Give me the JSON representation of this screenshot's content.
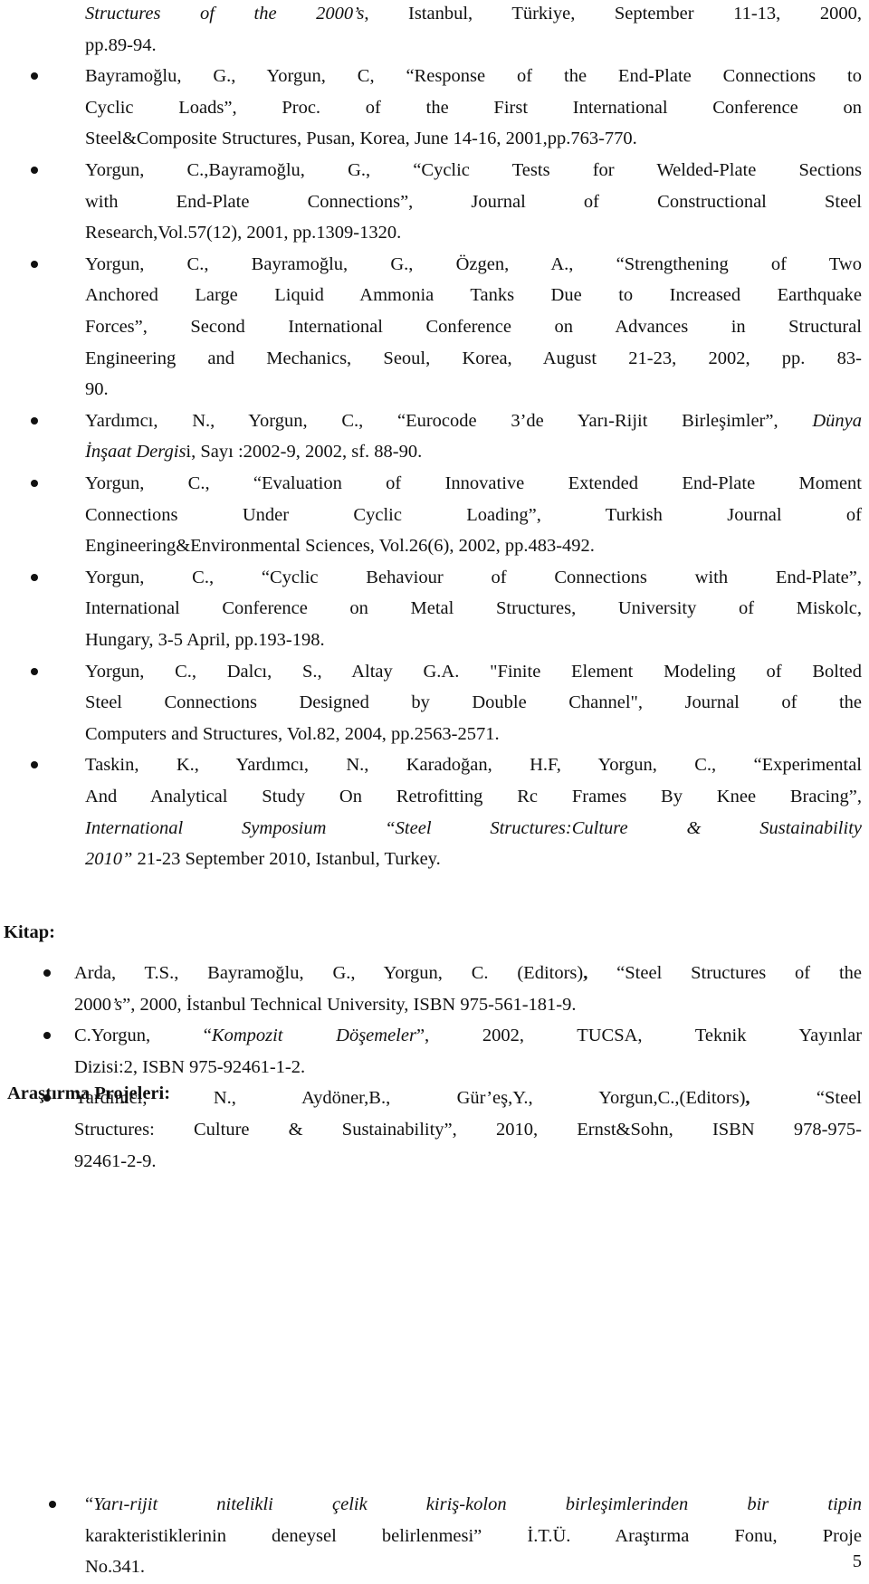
{
  "publications": {
    "items": [
      {
        "lines": [
          [
            {
              "t": "Structures of the 2000’s",
              "i": true
            },
            {
              "t": ", Istanbul, Türkiye, September 11-13, 2000,"
            }
          ],
          [
            {
              "t": "pp.89-94."
            }
          ]
        ],
        "bullet": false
      },
      {
        "lines": [
          [
            {
              "t": "Bayramoğlu, G., Yorgun, C, “Response of the End-Plate Connections to"
            }
          ],
          [
            {
              "t": "Cyclic Loads”, Proc. of the First International Conference on"
            }
          ],
          [
            {
              "t": "Steel&Composite Structures, Pusan, Korea, June 14-16, 2001,pp.763-770."
            }
          ]
        ],
        "bullet": true
      },
      {
        "lines": [
          [
            {
              "t": "Yorgun, C.,Bayramoğlu, G., “Cyclic Tests for Welded-Plate Sections"
            }
          ],
          [
            {
              "t": "with End-Plate Connections”, Journal of  Constructional Steel"
            }
          ],
          [
            {
              "t": "Research,Vol.57(12), 2001, pp.1309-1320."
            }
          ]
        ],
        "bullet": true
      },
      {
        "lines": [
          [
            {
              "t": "Yorgun, C., Bayramoğlu, G., Özgen, A., “Strengthening of Two"
            }
          ],
          [
            {
              "t": "Anchored Large Liquid Ammonia Tanks Due to Increased Earthquake"
            }
          ],
          [
            {
              "t": "Forces”, Second International Conference on Advances in Structural"
            }
          ],
          [
            {
              "t": "Engineering and Mechanics, Seoul, Korea, August 21-23, 2002, pp. 83-"
            }
          ],
          [
            {
              "t": "90."
            }
          ]
        ],
        "bullet": true
      },
      {
        "lines": [
          [
            {
              "t": "Yardımcı, N., Yorgun, C., “Eurocode 3’de Yarı-Rijit Birleşimler”, "
            },
            {
              "t": "Dünya",
              "i": true
            }
          ],
          [
            {
              "t": "İnşaat Dergis",
              "i": true
            },
            {
              "t": "i, Sayı :2002-9, 2002, sf. 88-90."
            }
          ]
        ],
        "bullet": true
      },
      {
        "lines": [
          [
            {
              "t": "Yorgun, C., “Evaluation of Innovative Extended End-Plate Moment"
            }
          ],
          [
            {
              "t": "Connections Under Cyclic Loading”, Turkish Journal of"
            }
          ],
          [
            {
              "t": "Engineering&Environmental Sciences, Vol.26(6), 2002, pp.483-492."
            }
          ]
        ],
        "bullet": true
      },
      {
        "lines": [
          [
            {
              "t": "Yorgun, C., “Cyclic Behaviour of Connections with End-Plate”,"
            }
          ],
          [
            {
              "t": "International Conference on Metal Structures, University of Miskolc,"
            }
          ],
          [
            {
              "t": "Hungary, 3-5 April, pp.193-198."
            }
          ]
        ],
        "bullet": true
      },
      {
        "lines": [
          [
            {
              "t": "Yorgun, C., Dalcı, S., Altay G.A. \"Finite Element Modeling of Bolted"
            }
          ],
          [
            {
              "t": "Steel Connections Designed by Double Channel\", Journal of the"
            }
          ],
          [
            {
              "t": "Computers and Structures, Vol.82, 2004, pp.2563-2571."
            }
          ]
        ],
        "bullet": true
      },
      {
        "lines": [
          [
            {
              "t": "Taskin, K., Yardımcı, N., Karadoğan, H.F, Yorgun, C., “Experimental"
            }
          ],
          [
            {
              "t": "And Analytical Study On Retrofitting Rc Frames By Knee Bracing”,"
            }
          ],
          [
            {
              "t": "International Symposium “Steel Structures:Culture & Sustainability",
              "i": true
            }
          ],
          [
            {
              "t": "2010”",
              "i": true
            },
            {
              "t": " 21-23 September 2010, Istanbul, Turkey."
            }
          ]
        ],
        "bullet": true
      }
    ]
  },
  "books": {
    "heading": "Kitap:",
    "items": [
      {
        "lines": [
          [
            {
              "t": "Arda, T.S., Bayramoğlu, G., Yorgun, C. (Editors)"
            },
            {
              "t": ",",
              "b": true
            },
            {
              "t": " “Steel Structures of the"
            }
          ],
          [
            {
              "t": "2000"
            },
            {
              "t": "’s",
              "i": true
            },
            {
              "t": "”, 2000, İstanbul Technical University, ISBN 975-561-181-9."
            }
          ]
        ]
      },
      {
        "lines": [
          [
            {
              "t": "C.Yorgun, “"
            },
            {
              "t": "Kompozit Döşemeler",
              "i": true
            },
            {
              "t": "”, 2002, TUCSA, Teknik Yayınlar"
            }
          ],
          [
            {
              "t": "Dizisi:2,  ISBN 975-92461-1-2."
            }
          ]
        ]
      },
      {
        "lines": [
          [
            {
              "t": "Yardımcı, N., Aydöner,B., Gür’eş,Y., Yorgun,C.,(Editors)"
            },
            {
              "t": ",",
              "b": true
            },
            {
              "t": " “Steel"
            }
          ],
          [
            {
              "t": "Structures: Culture & Sustainability”, 2010, Ernst&Sohn, ISBN 978-975-"
            }
          ],
          [
            {
              "t": "92461-2-9."
            }
          ]
        ]
      }
    ]
  },
  "projects": {
    "heading": "Araştırma Projeleri:",
    "items": [
      {
        "lines": [
          [
            {
              "t": "“"
            },
            {
              "t": "Yarı-rijit nitelikli çelik kiriş-kolon birleşimlerinden bir tipin",
              "i": true
            }
          ],
          [
            {
              "t": "karakteristiklerinin deneysel belirlenmesi”  İ.T.Ü. Araştırma Fonu, Proje"
            }
          ],
          [
            {
              "t": "No.341."
            }
          ]
        ]
      }
    ]
  },
  "page_number": "5"
}
